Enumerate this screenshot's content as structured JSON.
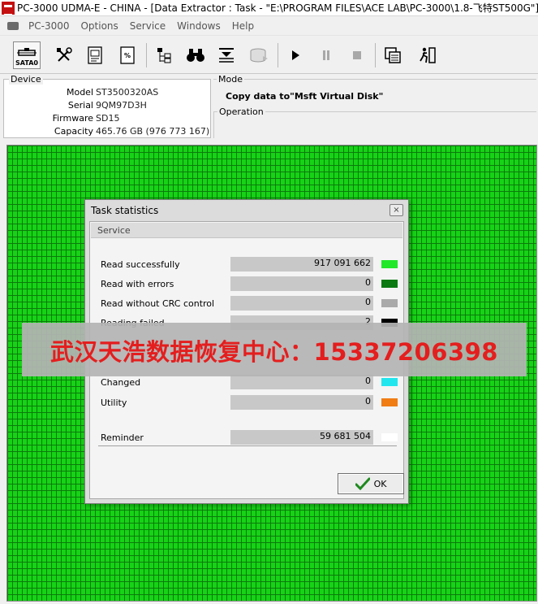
{
  "window": {
    "title": "PC-3000 UDMA-E - CHINA - [Data Extractor : Task - \"E:\\PROGRAM FILES\\ACE LAB\\PC-3000\\1.8-飞特ST500G\"]"
  },
  "menu": {
    "items": [
      "PC-3000",
      "Options",
      "Service",
      "Windows",
      "Help"
    ]
  },
  "toolbar": {
    "sata_label": "SATA0",
    "icons": [
      "sata-port-icon",
      "tools-icon",
      "disk-info-icon",
      "percent-icon",
      "tree-icon",
      "binoculars-icon",
      "sector-edit-icon",
      "drive-export-icon",
      "play-icon",
      "pause-icon",
      "stop-icon",
      "window-list-icon",
      "exit-icon"
    ]
  },
  "device": {
    "legend": "Device",
    "fields": [
      {
        "key": "Model",
        "value": "ST3500320AS"
      },
      {
        "key": "Serial",
        "value": "9QM97D3H"
      },
      {
        "key": "Firmware",
        "value": "SD15"
      },
      {
        "key": "Capacity",
        "value": "465.76 GB (976 773 167)"
      }
    ]
  },
  "mode": {
    "legend": "Mode",
    "text": "Copy data to\"Msft Virtual Disk\""
  },
  "operation": {
    "legend": "Operation"
  },
  "dialog": {
    "title": "Task statistics",
    "close_label": "×",
    "section": "Service",
    "rows": [
      {
        "label": "Read successfully",
        "value": "917 091 662",
        "color": "#22e82a"
      },
      {
        "label": "Read with errors",
        "value": "0",
        "color": "#0b7a12"
      },
      {
        "label": "Read without CRC control",
        "value": "0",
        "color": "#aaaaaa"
      },
      {
        "label": "Reading failed",
        "value": "2",
        "color": "#000000"
      },
      {
        "label": "Changed",
        "value": "0",
        "color": "#22e6ee"
      },
      {
        "label": "Utility",
        "value": "0",
        "color": "#f07c14"
      }
    ],
    "reminder": {
      "label": "Reminder",
      "value": "59 681 504",
      "color": "#ffffff"
    },
    "ok_label": "OK"
  },
  "watermark": {
    "text": "武汉天浩数据恢复中心：15337206398"
  }
}
